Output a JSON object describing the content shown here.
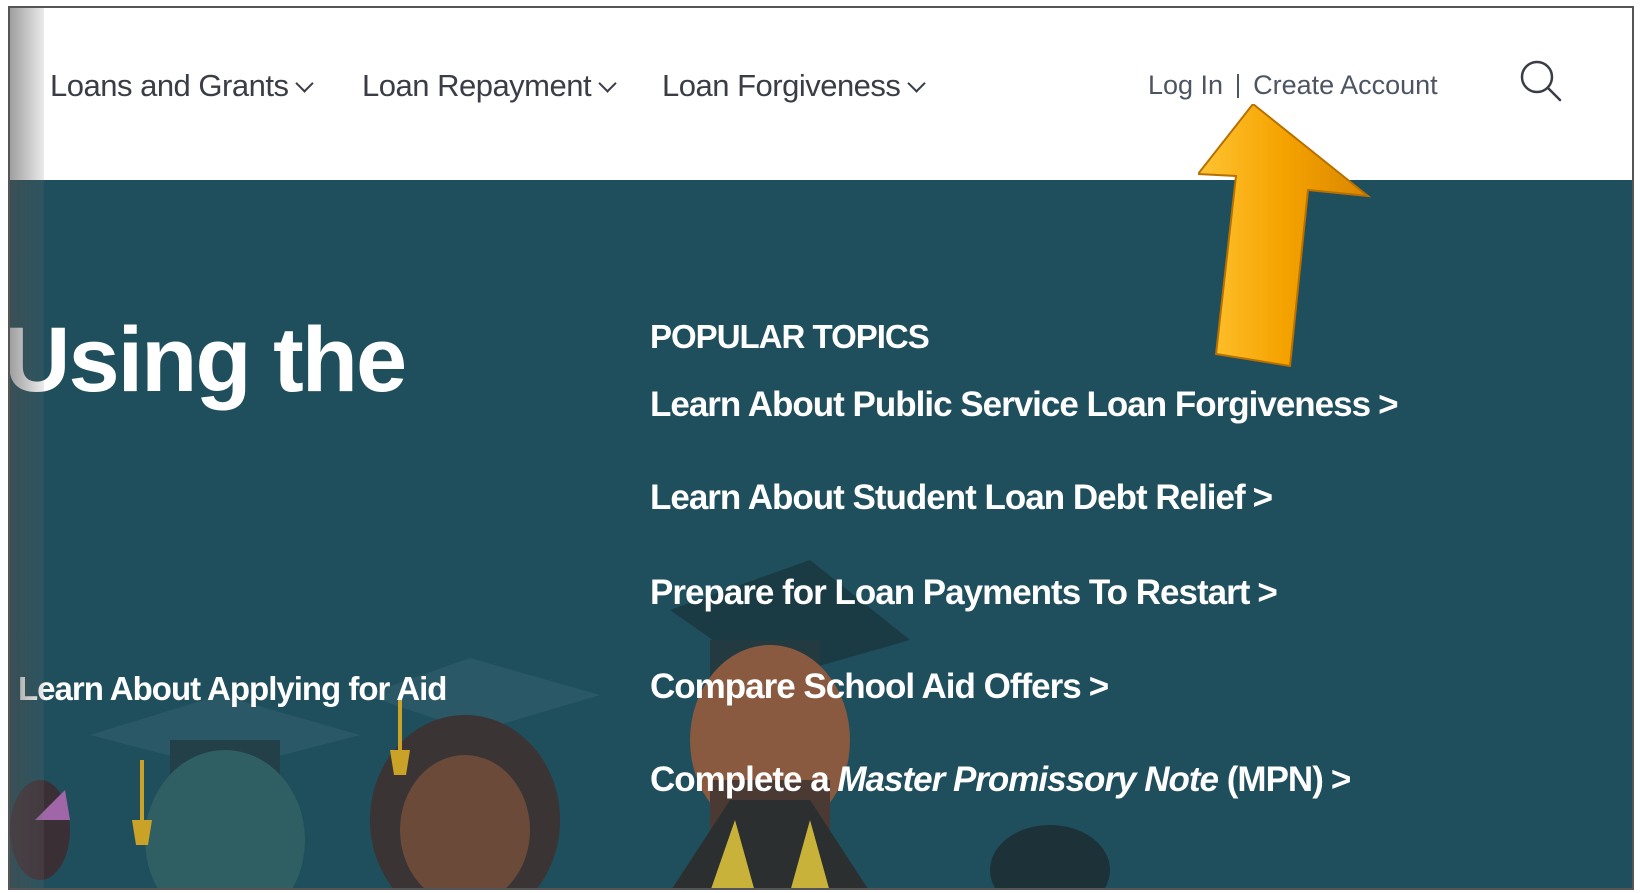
{
  "nav": {
    "items": [
      {
        "label": "Loans and Grants"
      },
      {
        "label": "Loan Repayment"
      },
      {
        "label": "Loan Forgiveness"
      }
    ]
  },
  "account": {
    "login_label": "Log In",
    "create_label": "Create Account"
  },
  "hero": {
    "title": "Using the",
    "link": "Learn About Applying for Aid"
  },
  "popular_topics": {
    "heading": "POPULAR TOPICS",
    "items": [
      {
        "text": "Learn About Public Service Loan Forgiveness"
      },
      {
        "text": "Learn About Student Loan Debt Relief"
      },
      {
        "text": "Prepare for Loan Payments To Restart"
      },
      {
        "text": "Compare School Aid Offers"
      },
      {
        "pre": "Complete a",
        "italic": "Master Promissory Note",
        "post": "(MPN)"
      }
    ],
    "chevron": ">"
  },
  "colors": {
    "hero_bg": "#1f4e5c",
    "nav_text": "#3a3d45",
    "arrow": "#f5a300"
  }
}
